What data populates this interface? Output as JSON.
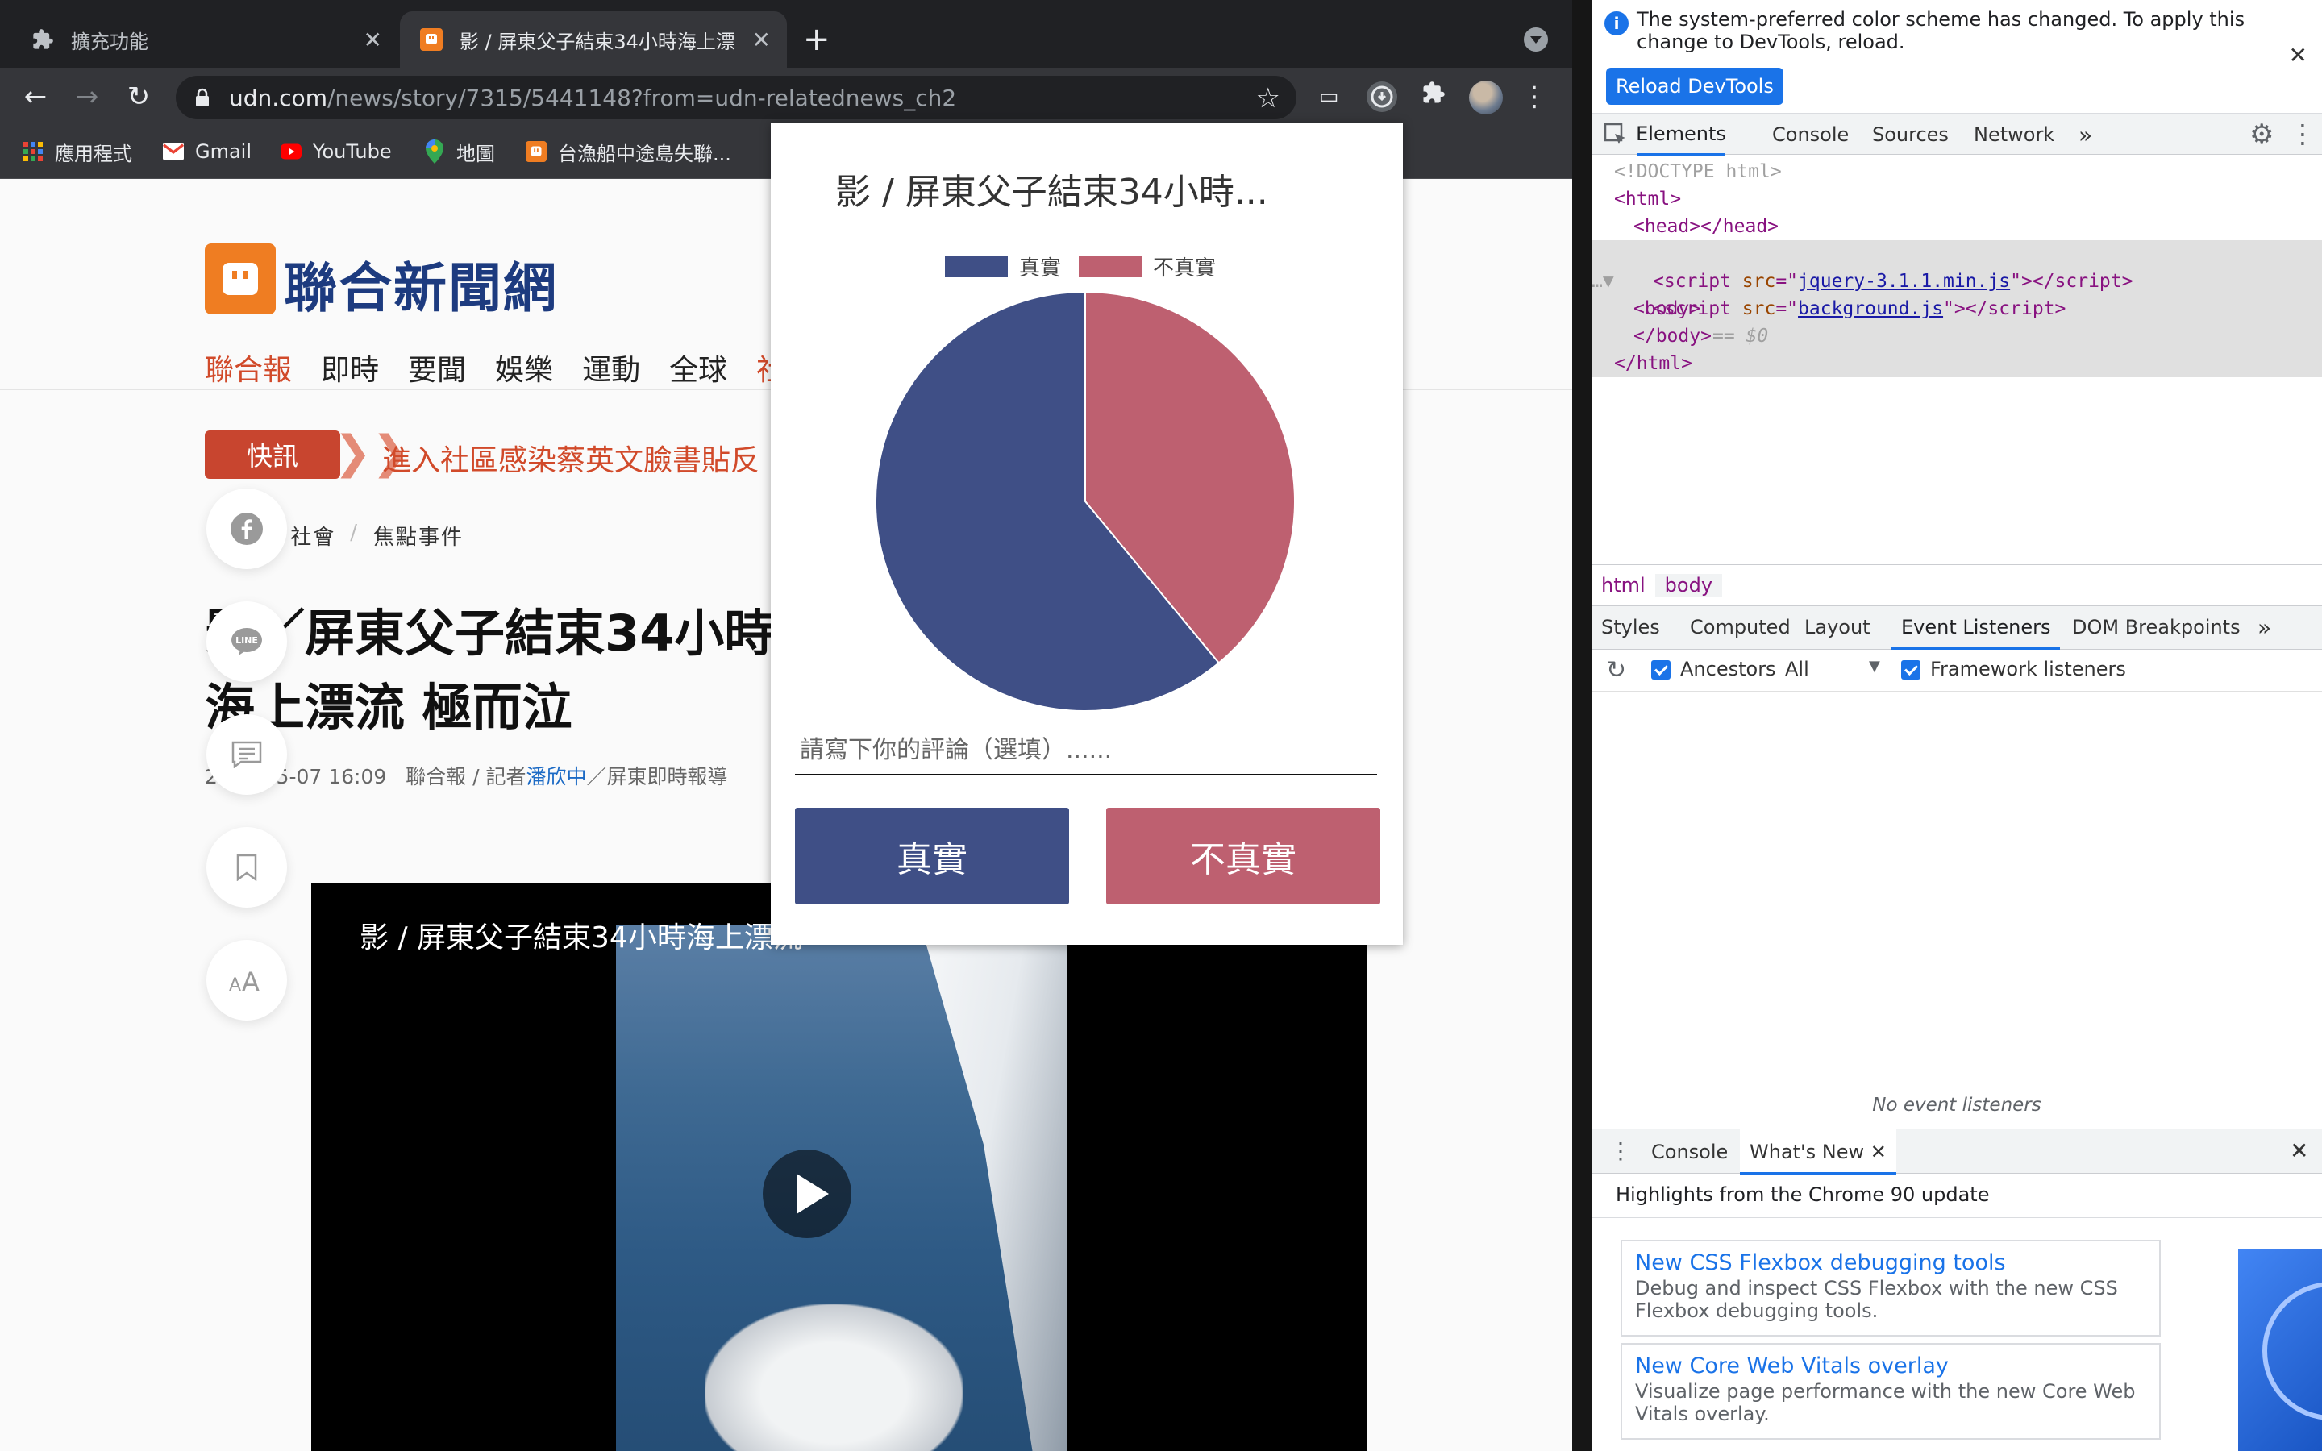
{
  "browser": {
    "tabs": [
      {
        "title": "擴充功能",
        "icon": "puzzle-icon"
      },
      {
        "title": "影 / 屏東父子結束34小時海上漂",
        "icon": "udn-favicon"
      }
    ],
    "url": {
      "host": "udn.com",
      "path": "/news/story/7315/5441148?from=udn-relatednews_ch2"
    },
    "bookmarks": [
      {
        "label": "應用程式",
        "icon": "apps-grid-icon"
      },
      {
        "label": "Gmail",
        "icon": "gmail-icon"
      },
      {
        "label": "YouTube",
        "icon": "youtube-icon"
      },
      {
        "label": "地圖",
        "icon": "maps-pin-icon"
      },
      {
        "label": "台漁船中途島失聯...",
        "icon": "udn-favicon"
      }
    ]
  },
  "page": {
    "site_name": "聯合新聞網",
    "nav": [
      "聯合報",
      "即時",
      "要聞",
      "娛樂",
      "運動",
      "全球",
      "社"
    ],
    "flash_label": "快訊",
    "flash_text": "進入社區感染蔡英文臉書貼反",
    "breadcrumbs": [
      "udn",
      "社會",
      "焦點事件"
    ],
    "article_title": "影／屏東父子結束34小時海上漂流 極而泣",
    "meta": {
      "date": "2021-05-07 16:09",
      "source": "聯合報 / 記者",
      "author": "潘欣中",
      "suffix": "／屏東即時報導"
    },
    "video_title": "影 / 屏東父子結束34小時海上漂流",
    "share_icons": [
      "facebook-icon",
      "line-icon",
      "comment-icon",
      "bookmark-icon",
      "font-size-icon"
    ]
  },
  "popup": {
    "title": "影 / 屏東父子結束34小時...",
    "comment_placeholder": "請寫下你的評論（選填）......",
    "btn_true": "真實",
    "btn_false": "不真實"
  },
  "chart_data": {
    "type": "pie",
    "title": "影 / 屏東父子結束34小時...",
    "legend_position": "top",
    "labels": [
      "真實",
      "不真實"
    ],
    "values": [
      61,
      39
    ],
    "colors": [
      "#3f4f86",
      "#be6070"
    ]
  },
  "devtools": {
    "info_text": "The system-preferred color scheme has changed. To apply this change to DevTools, reload.",
    "reload_label": "Reload DevTools",
    "main_tabs": [
      "Elements",
      "Console",
      "Sources",
      "Network"
    ],
    "tree": {
      "doctype": "<!DOCTYPE html>",
      "html_open": "<html>",
      "head": "<head></head>",
      "body_open": "<body>",
      "body_marker": "== $0",
      "script1_src": "jquery-3.1.1.min.js",
      "script2_src": "background.js",
      "body_close": "</body>",
      "html_close": "</html>"
    },
    "crumbs": [
      "html",
      "body"
    ],
    "sub_tabs": [
      "Styles",
      "Computed",
      "Layout",
      "Event Listeners",
      "DOM Breakpoints"
    ],
    "listener_bar": {
      "ancestors": "Ancestors",
      "filter": "All",
      "framework": "Framework listeners"
    },
    "no_listeners": "No event listeners",
    "drawer_tabs": [
      "Console",
      "What's New"
    ],
    "whats_new_heading": "Highlights from the Chrome 90 update",
    "cards": [
      {
        "title": "New CSS Flexbox debugging tools",
        "desc": "Debug and inspect CSS Flexbox with the new CSS Flexbox debugging tools."
      },
      {
        "title": "New Core Web Vitals overlay",
        "desc": "Visualize page performance with the new Core Web Vitals overlay."
      }
    ]
  }
}
